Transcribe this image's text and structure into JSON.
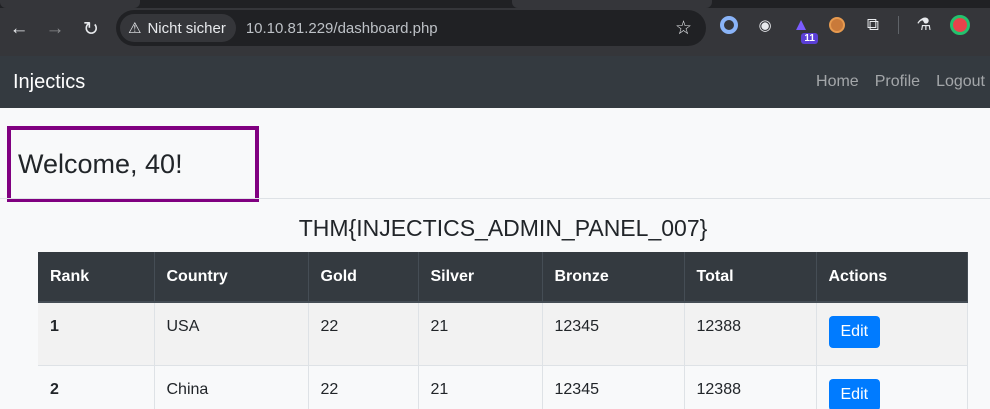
{
  "browser": {
    "security_label": "Nicht sicher",
    "url": "10.10.81.229/dashboard.php",
    "extension_badge": "11"
  },
  "navbar": {
    "brand": "Injectics",
    "links": [
      "Home",
      "Profile",
      "Logout"
    ]
  },
  "page": {
    "welcome": "Welcome, 40!",
    "flag": "THM{INJECTICS_ADMIN_PANEL_007}"
  },
  "table": {
    "headers": [
      "Rank",
      "Country",
      "Gold",
      "Silver",
      "Bronze",
      "Total",
      "Actions"
    ],
    "rows": [
      {
        "rank": "1",
        "country": "USA",
        "gold": "22",
        "silver": "21",
        "bronze": "12345",
        "total": "12388",
        "action": "Edit"
      },
      {
        "rank": "2",
        "country": "China",
        "gold": "22",
        "silver": "21",
        "bronze": "12345",
        "total": "12388",
        "action": "Edit"
      }
    ]
  },
  "colors": {
    "highlight_border": "#800080",
    "navbar_bg": "#343a40",
    "button_primary": "#007bff"
  }
}
